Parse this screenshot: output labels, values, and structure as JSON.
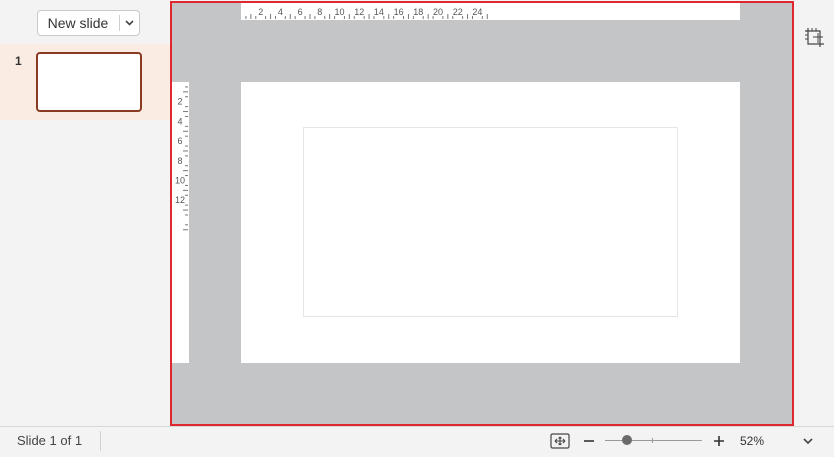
{
  "left_panel": {
    "new_slide_label": "New slide",
    "thumbnails": [
      {
        "number": "1"
      }
    ]
  },
  "ruler": {
    "horizontal_labels": [
      "2",
      "4",
      "6",
      "8",
      "10",
      "12",
      "14",
      "16",
      "18",
      "20",
      "22",
      "24"
    ],
    "vertical_labels": [
      "2",
      "4",
      "6",
      "8",
      "10",
      "12"
    ]
  },
  "status_bar": {
    "slide_counter": "Slide 1 of 1",
    "zoom_value": "52%",
    "zoom_fraction": 0.23
  },
  "icons": {
    "new_slide_dropdown": "chevron-down-icon",
    "slide_settings": "crop-grid-icon",
    "fit_to_slide": "fit-screen-icon",
    "zoom_out": "minus-icon",
    "zoom_in": "plus-icon",
    "zoom_menu": "chevron-down-icon"
  },
  "colors": {
    "accent_border": "#e0262e",
    "thumbnail_selected": "#8b3a22",
    "thumbnail_row_bg": "#fbece3",
    "workspace_bg": "#c3c5c7"
  }
}
